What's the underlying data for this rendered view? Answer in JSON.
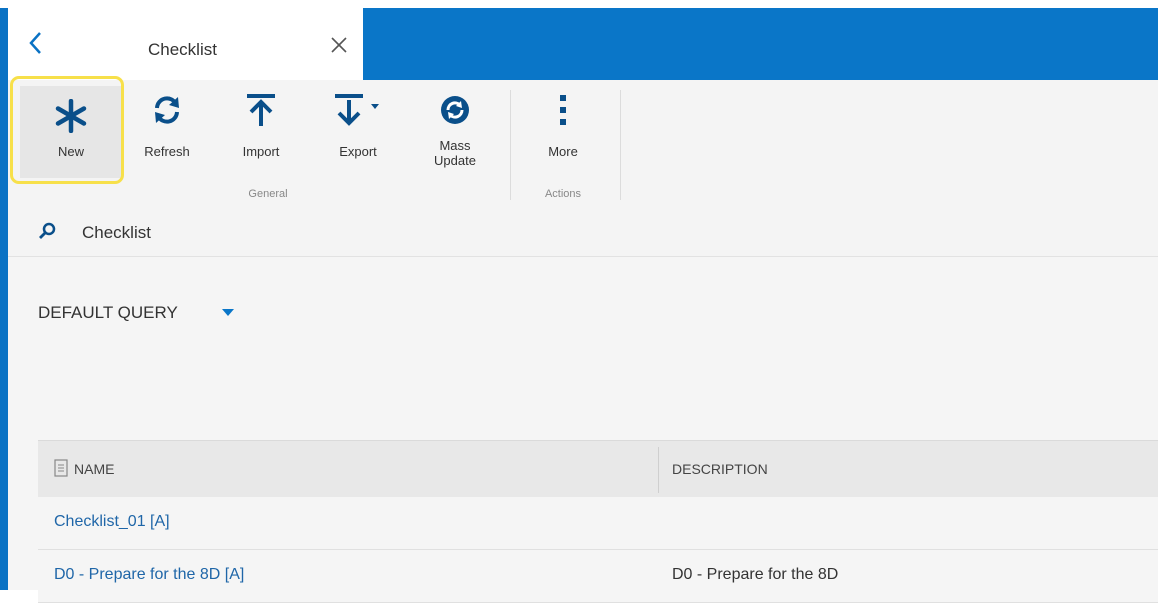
{
  "tab": {
    "title": "Checklist"
  },
  "toolbar": {
    "new_label": "New",
    "refresh_label": "Refresh",
    "import_label": "Import",
    "export_label": "Export",
    "mass_update_label": "Mass\nUpdate",
    "more_label": "More",
    "group_general": "General",
    "group_actions": "Actions"
  },
  "search": {
    "label": "Checklist"
  },
  "query": {
    "label": "DEFAULT QUERY"
  },
  "grid": {
    "columns": [
      "NAME",
      "DESCRIPTION"
    ],
    "rows": [
      {
        "name": "Checklist_01 [A]",
        "description": ""
      },
      {
        "name": "D0 - Prepare for the 8D [A]",
        "description": "D0 - Prepare for the 8D"
      }
    ]
  },
  "colors": {
    "accent": "#0a76c8",
    "link": "#1f66a8",
    "highlight": "#f7e04a"
  }
}
